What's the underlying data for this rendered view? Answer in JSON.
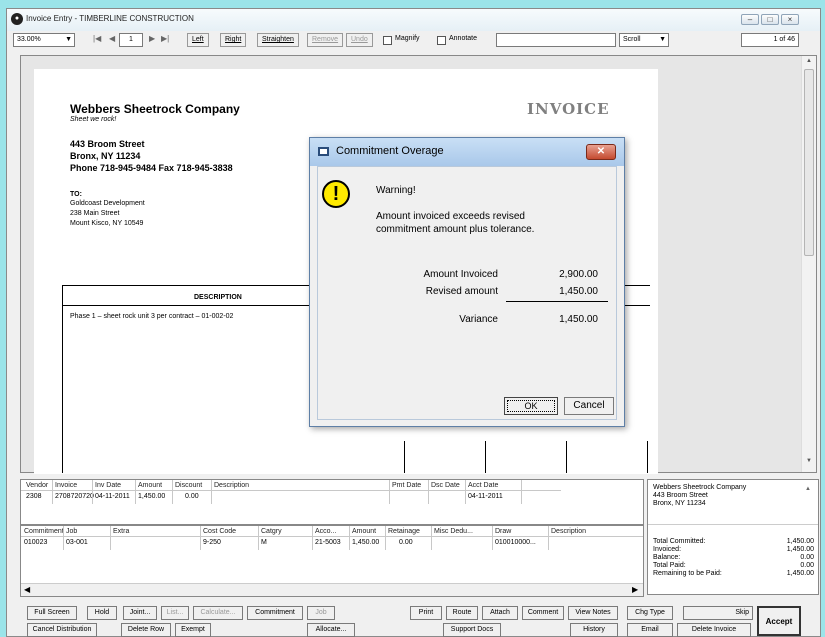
{
  "window": {
    "title": "Invoice Entry - TIMBERLINE CONSTRUCTION",
    "app_icon": "timberline-logo-icon"
  },
  "toolbar": {
    "zoom": "33.00%",
    "page_current": "1",
    "left": "Left",
    "right": "Right",
    "straighten": "Straighten",
    "remove": "Remove",
    "undo": "Undo",
    "magnify": "Magnify",
    "annotate": "Annotate",
    "scroll_mode": "Scroll",
    "page_of": "1 of 46"
  },
  "invoice_doc": {
    "company": "Webbers Sheetrock Company",
    "tagline": "Sheet we rock!",
    "title": "INVOICE",
    "address1": "443 Broom Street",
    "address2": "Bronx, NY 11234",
    "phone": "Phone 718-945-9484  Fax 718-945-3838",
    "to_label": "TO:",
    "to_lines": [
      "Goldcoast Development",
      "238 Main Street",
      "Mount Kisco, NY 10549"
    ],
    "desc_header": "DESCRIPTION",
    "desc_line": "Phase 1 – sheet rock unit 3 per contract – 01-002-02"
  },
  "dialog": {
    "title": "Commitment Overage",
    "warning": "Warning!",
    "message1": "Amount invoiced exceeds revised",
    "message2": "commitment amount plus tolerance.",
    "amount_invoiced_label": "Amount Invoiced",
    "amount_invoiced": "2,900.00",
    "revised_label": "Revised amount",
    "revised": "1,450.00",
    "variance_label": "Variance",
    "variance": "1,450.00",
    "ok": "OK",
    "cancel": "Cancel"
  },
  "header_grid": {
    "columns": [
      "Vendor",
      "Invoice",
      "Inv Date",
      "Amount",
      "Discount",
      "Description",
      "Pmt Date",
      "Dsc Date",
      "Acct Date"
    ],
    "row": [
      "2308",
      "2708720720",
      "04-11-2011",
      "1,450.00",
      "0.00",
      "",
      "",
      "",
      "04-11-2011"
    ]
  },
  "dist_grid": {
    "columns": [
      "Commitment",
      "Job",
      "Extra",
      "Cost Code",
      "Catgry",
      "Acco...",
      "Amount",
      "Retainage",
      "Misc Dedu...",
      "Draw",
      "Description"
    ],
    "row": [
      "010023",
      "03-001",
      "",
      "9-250",
      "M",
      "21-5003",
      "1,450.00",
      "0.00",
      "",
      "010010000...",
      ""
    ]
  },
  "side_info": {
    "vendor_lines": [
      "Webbers Sheetrock Company",
      "443 Broom Street",
      "Bronx, NY 11234"
    ],
    "totals": [
      {
        "label": "Total Committed:",
        "value": "1,450.00"
      },
      {
        "label": "Invoiced:",
        "value": "1,450.00"
      },
      {
        "label": "Balance:",
        "value": "0.00"
      },
      {
        "label": "Total Paid:",
        "value": "0.00"
      },
      {
        "label": "Remaining to be Paid:",
        "value": "1,450.00"
      }
    ]
  },
  "buttons": {
    "full_screen": "Full Screen",
    "hold": "Hold",
    "joint": "Joint...",
    "list": "List...",
    "calculate": "Calculate...",
    "commitment": "Commitment",
    "job": "Job",
    "print": "Print",
    "route": "Route",
    "attach": "Attach",
    "comment": "Comment",
    "view_notes": "View Notes",
    "chg_type": "Chg Type",
    "skip": "Skip",
    "accept": "Accept",
    "cancel_distribution": "Cancel Distribution",
    "delete_row": "Delete Row",
    "exempt": "Exempt",
    "allocate": "Allocate...",
    "support_docs": "Support Docs",
    "history": "History",
    "email": "Email",
    "delete_invoice": "Delete Invoice"
  }
}
